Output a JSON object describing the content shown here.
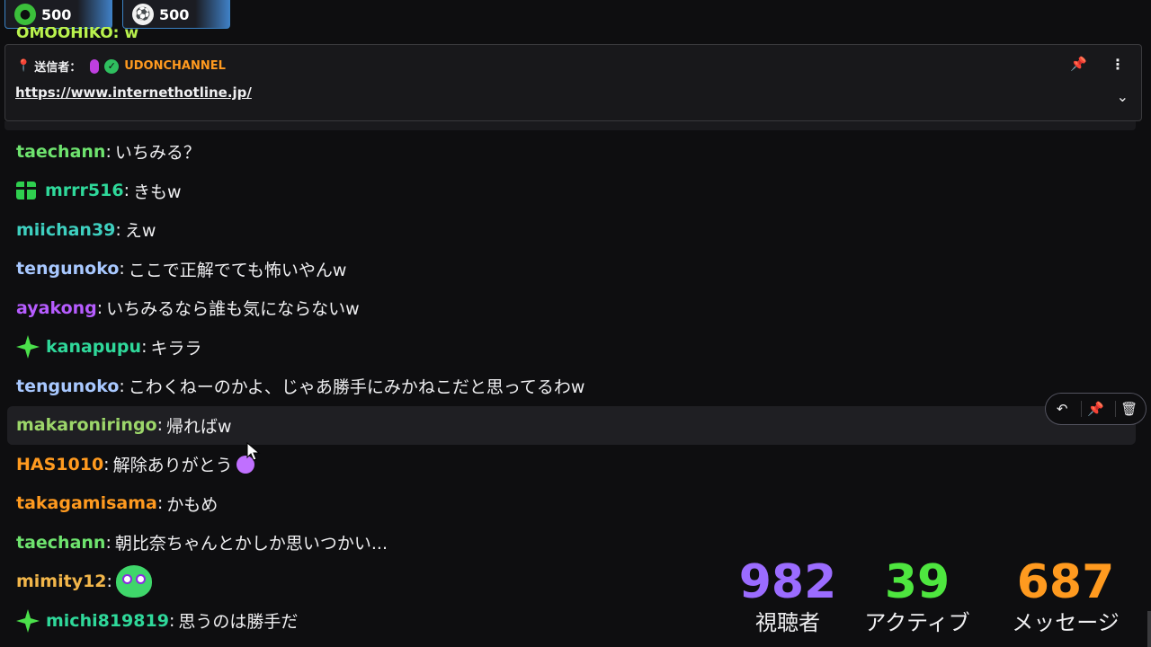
{
  "points": [
    {
      "icon": "green-emote-icon",
      "value": "500"
    },
    {
      "icon": "soccer-ball-icon",
      "value": "500"
    }
  ],
  "cut_off_text": "OMOOHIKO: w",
  "pinned": {
    "label": "送信者：",
    "user": "UDONCHANNEL",
    "link": "https://www.internethotline.jp/"
  },
  "messages": [
    {
      "user": "taechann",
      "color": "#6ee36e",
      "text": "いちみる？",
      "badge": ""
    },
    {
      "user": "mrrr516",
      "color": "#2fd89a",
      "text": "きもw",
      "badge": "gift"
    },
    {
      "user": "miichan39",
      "color": "#3ecfbf",
      "text": "えw",
      "badge": ""
    },
    {
      "user": "tengunoko",
      "color": "#a8c8ff",
      "text": "ここで正解でても怖いやんw",
      "badge": ""
    },
    {
      "user": "ayakong",
      "color": "#b65cff",
      "text": "いちみるなら誰も気にならないw",
      "badge": ""
    },
    {
      "user": "kanapupu",
      "color": "#2fd89a",
      "text": "キララ",
      "badge": "sparkle"
    },
    {
      "user": "tengunoko",
      "color": "#a8c8ff",
      "text": "こわくねーのかよ、じゃあ勝手にみかねこだと思ってるわw",
      "badge": ""
    },
    {
      "user": "makaroniringo",
      "color": "#9cd66a",
      "text": "帰ればw",
      "badge": ""
    },
    {
      "user": "HAS1010",
      "color": "#ff9a1f",
      "text": "解除ありがとう",
      "badge": ""
    },
    {
      "user": "takagamisama",
      "color": "#ff9a1f",
      "text": "かもめ",
      "badge": ""
    },
    {
      "user": "taechann",
      "color": "#6ee36e",
      "text": "朝比奈ちゃんとかしか思いつかい...",
      "badge": ""
    },
    {
      "user": "mimity12",
      "color": "#f2b64a",
      "text": "",
      "badge": ""
    },
    {
      "user": "michi819819",
      "color": "#2fd89a",
      "text": "思うのは勝手だ",
      "badge": "sparkle"
    }
  ],
  "hover_actions": {
    "reply": "↶",
    "pin": "📌",
    "delete": "🗑"
  },
  "stats": [
    {
      "value": "982",
      "label": "視聴者",
      "color": "#9b6cff"
    },
    {
      "value": "39",
      "label": "アクティブ",
      "color": "#4ee63f"
    },
    {
      "value": "687",
      "label": "メッセージ",
      "color": "#ff9a1f"
    }
  ]
}
